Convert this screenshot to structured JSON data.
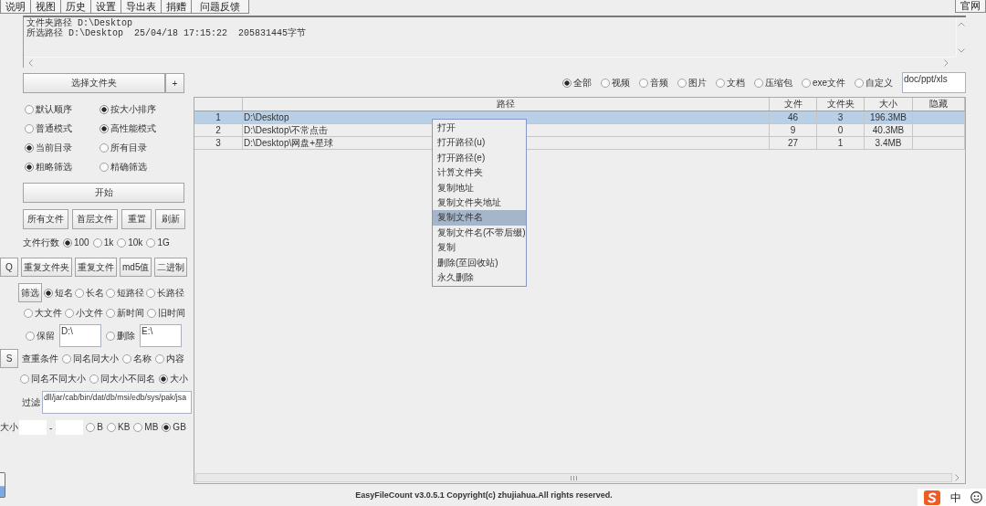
{
  "menu_bar": {
    "items": [
      "说明",
      "视图",
      "历史",
      "设置",
      "导出表",
      "捐赠",
      "问题反馈"
    ],
    "website_button": "官网"
  },
  "info_panel": {
    "lines": [
      "文件夹路径 D:\\Desktop",
      "所选路径 D:\\Desktop  25/04/18 17:15:22  205831445字节"
    ]
  },
  "left_panel": {
    "select_folder_button": "选择文件夹",
    "add_button": "+",
    "option_pairs": [
      {
        "options": [
          {
            "label": "默认顺序",
            "selected": false
          },
          {
            "label": "按大小排序",
            "selected": true
          }
        ]
      },
      {
        "options": [
          {
            "label": "普通模式",
            "selected": false
          },
          {
            "label": "高性能模式",
            "selected": true
          }
        ]
      },
      {
        "options": [
          {
            "label": "当前目录",
            "selected": true
          },
          {
            "label": "所有目录",
            "selected": false
          }
        ]
      },
      {
        "options": [
          {
            "label": "粗略筛选",
            "selected": true
          },
          {
            "label": "精确筛选",
            "selected": false
          }
        ]
      }
    ],
    "start_button": "开始",
    "action_buttons": [
      "所有文件",
      "首层文件",
      "重置",
      "刷新"
    ],
    "row_limit": {
      "label": "文件行数",
      "options": [
        {
          "label": "100",
          "selected": true
        },
        {
          "label": "1k",
          "selected": false
        },
        {
          "label": "10k",
          "selected": false
        },
        {
          "label": "1G",
          "selected": false
        }
      ]
    },
    "duplicate_tools": {
      "side_button": "Q",
      "buttons": [
        "重复文件夹",
        "重复文件",
        "md5值",
        "二进制"
      ]
    },
    "name_filter": {
      "button": "筛选",
      "options": [
        {
          "label": "短名",
          "selected": true
        },
        {
          "label": "长名",
          "selected": false
        },
        {
          "label": "短路径",
          "selected": false
        },
        {
          "label": "长路径",
          "selected": false
        }
      ]
    },
    "order_options": [
      {
        "label": "大文件",
        "selected": false
      },
      {
        "label": "小文件",
        "selected": false
      },
      {
        "label": "新时间",
        "selected": false
      },
      {
        "label": "旧时间",
        "selected": false
      }
    ],
    "path_rules": [
      {
        "label": "保留",
        "selected": false,
        "value": "D:\\"
      },
      {
        "label": "删除",
        "selected": false,
        "value": "E:\\"
      }
    ],
    "duplicate_criteria": {
      "side_button": "S",
      "label": "查重条件",
      "rows": [
        [
          {
            "label": "同名同大小",
            "selected": false
          },
          {
            "label": "名称",
            "selected": false
          },
          {
            "label": "内容",
            "selected": false
          }
        ],
        [
          {
            "label": "同名不同大小",
            "selected": false
          },
          {
            "label": "同大小不同名",
            "selected": false
          },
          {
            "label": "大小",
            "selected": true
          }
        ]
      ]
    },
    "extension_filter": {
      "label": "过滤",
      "value": "dll/jar/cab/bin/dat/db/msi/edb/sys/pak/jsa"
    },
    "size_range": {
      "label": "大小",
      "separator": "-",
      "units": [
        {
          "label": "B",
          "selected": false
        },
        {
          "label": "KB",
          "selected": false
        },
        {
          "label": "MB",
          "selected": false
        },
        {
          "label": "GB",
          "selected": true
        }
      ]
    }
  },
  "type_filter": {
    "options": [
      {
        "label": "全部",
        "selected": true
      },
      {
        "label": "视频",
        "selected": false
      },
      {
        "label": "音频",
        "selected": false
      },
      {
        "label": "图片",
        "selected": false
      },
      {
        "label": "文档",
        "selected": false
      },
      {
        "label": "压缩包",
        "selected": false
      },
      {
        "label": "exe文件",
        "selected": false
      },
      {
        "label": "自定义",
        "selected": false
      }
    ],
    "custom_extensions": "doc/ppt/xls"
  },
  "table": {
    "columns": [
      "路径",
      "文件",
      "文件夹",
      "大小",
      "隐藏"
    ],
    "rows": [
      {
        "number": "1",
        "path": "D:\\Desktop",
        "files": "46",
        "folders": "3",
        "size": "196.3MB",
        "selected": true
      },
      {
        "number": "2",
        "path": "D:\\Desktop\\不常点击",
        "files": "9",
        "folders": "0",
        "size": "40.3MB",
        "selected": false
      },
      {
        "number": "3",
        "path": "D:\\Desktop\\网盘+星球",
        "files": "27",
        "folders": "1",
        "size": "3.4MB",
        "selected": false
      }
    ]
  },
  "context_menu": {
    "items": [
      {
        "label": "打开",
        "selected": false
      },
      {
        "label": "打开路径(u)",
        "selected": false
      },
      {
        "label": "打开路径(e)",
        "selected": false
      },
      {
        "label": "计算文件夹",
        "selected": false
      },
      {
        "label": "复制地址",
        "selected": false
      },
      {
        "label": "复制文件夹地址",
        "selected": false
      },
      {
        "label": "复制文件名",
        "selected": true
      },
      {
        "label": "复制文件名(不带后缀)",
        "selected": false
      },
      {
        "label": "复制",
        "selected": false
      },
      {
        "label": "删除(至回收站)",
        "selected": false
      },
      {
        "label": "永久删除",
        "selected": false
      }
    ]
  },
  "footer": "EasyFileCount v3.0.5.1 Copyright(c) zhujiahua.All rights reserved.",
  "tray": {
    "input_mode": "中"
  }
}
